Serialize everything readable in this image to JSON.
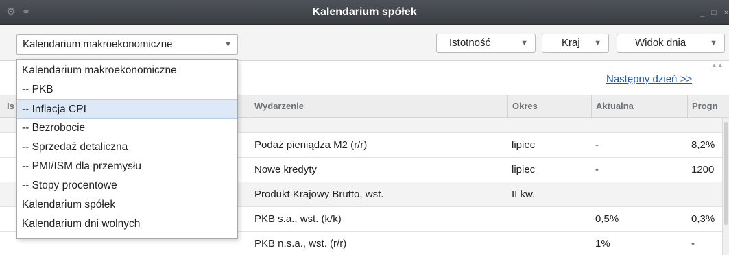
{
  "window": {
    "title": "Kalendarium spółek",
    "minimize": "_",
    "maximize": "□",
    "close": "×"
  },
  "toolbar": {
    "calendar_select": {
      "value": "Kalendarium makroekonomiczne",
      "arrow": "▼"
    },
    "importance": {
      "label": "Istotność",
      "arrow": "▼"
    },
    "country": {
      "label": "Kraj",
      "arrow": "▼"
    },
    "day_view": {
      "label": "Widok dnia",
      "arrow": "▼"
    }
  },
  "nav": {
    "next_day": "Następny dzień >>"
  },
  "table": {
    "headers": {
      "importance_short": "Is",
      "event": "Wydarzenie",
      "period": "Okres",
      "actual": "Aktualna",
      "forecast": "Progn"
    },
    "rows": [
      {
        "event": "",
        "period": "",
        "actual": "",
        "forecast": ""
      },
      {
        "event": "Podaż pieniądza M2 (r/r)",
        "period": "lipiec",
        "actual": "-",
        "forecast": "8,2%"
      },
      {
        "event": "Nowe kredyty",
        "period": "lipiec",
        "actual": "-",
        "forecast": "1200"
      },
      {
        "event": "Produkt Krajowy Brutto, wst.",
        "period": "II kw.",
        "actual": "",
        "forecast": ""
      },
      {
        "event": "PKB s.a., wst. (k/k)",
        "period": "",
        "actual": "0,5%",
        "forecast": "0,3%"
      },
      {
        "event": "PKB n.s.a., wst. (r/r)",
        "period": "",
        "actual": "1%",
        "forecast": "-"
      }
    ]
  },
  "dropdown": {
    "items": [
      "Kalendarium makroekonomiczne",
      "-- PKB",
      "-- Inflacja CPI",
      "-- Bezrobocie",
      "-- Sprzedaż detaliczna",
      "-- PMI/ISM dla przemysłu",
      "-- Stopy procentowe",
      "Kalendarium spółek",
      "Kalendarium dni wolnych"
    ],
    "highlighted": "-- Inflacja CPI"
  }
}
